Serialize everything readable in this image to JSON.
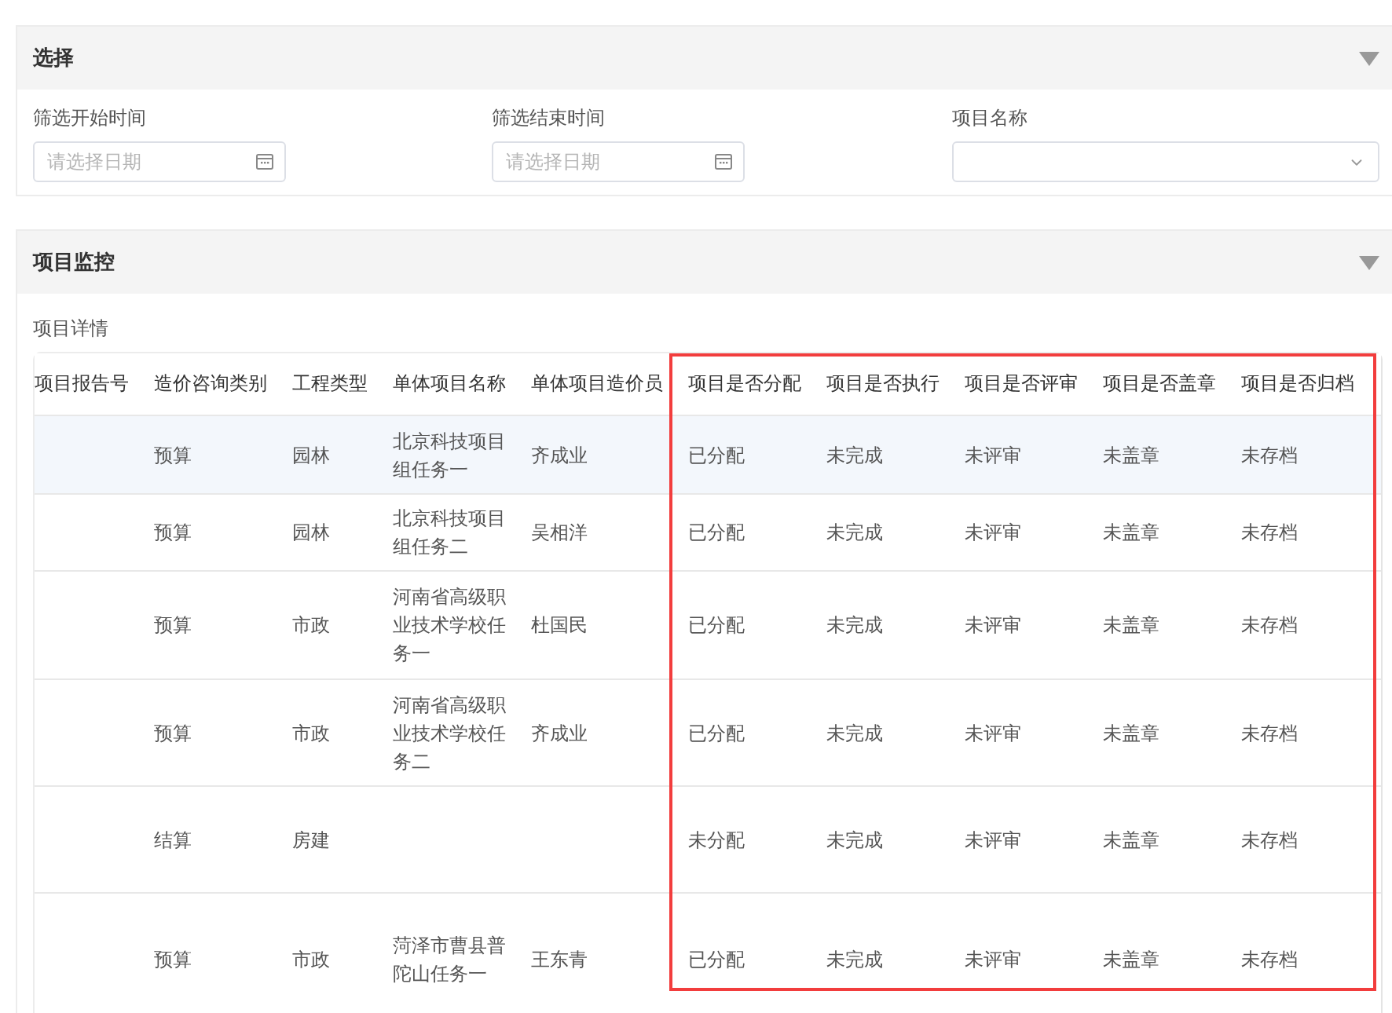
{
  "filter_panel": {
    "title": "选择",
    "fields": [
      {
        "label": "筛选开始时间",
        "kind": "date",
        "placeholder": "请选择日期"
      },
      {
        "label": "筛选结束时间",
        "kind": "date",
        "placeholder": "请选择日期"
      },
      {
        "label": "项目名称",
        "kind": "select"
      }
    ]
  },
  "monitor_panel": {
    "title": "项目监控",
    "section_label": "项目详情",
    "table": {
      "columns": [
        "项目报告号",
        "造价咨询类别",
        "工程类型",
        "单体项目名称",
        "单体项目造价员",
        "项目是否分配",
        "项目是否执行",
        "项目是否评审",
        "项目是否盖章",
        "项目是否归档"
      ],
      "annotation": {
        "kind": "frame"
      },
      "rows": [
        {
          "hovered": true,
          "cells": [
            null,
            "预算",
            "园林",
            "北京科技项目组任务一",
            "齐成业",
            "已分配",
            "未完成",
            "未评审",
            "未盖章",
            "未存档"
          ]
        },
        {
          "hovered": false,
          "cells": [
            null,
            "预算",
            "园林",
            "北京科技项目组任务二",
            "吴相洋",
            "已分配",
            "未完成",
            "未评审",
            "未盖章",
            "未存档"
          ]
        },
        {
          "hovered": false,
          "cells": [
            null,
            "预算",
            "市政",
            "河南省高级职业技术学校任务一",
            "杜国民",
            "已分配",
            "未完成",
            "未评审",
            "未盖章",
            "未存档"
          ]
        },
        {
          "hovered": false,
          "cells": [
            null,
            "预算",
            "市政",
            "河南省高级职业技术学校任务二",
            "齐成业",
            "已分配",
            "未完成",
            "未评审",
            "未盖章",
            "未存档"
          ]
        },
        {
          "hovered": false,
          "cells": [
            null,
            "结算",
            "房建",
            null,
            null,
            "未分配",
            "未完成",
            "未评审",
            "未盖章",
            "未存档"
          ]
        },
        {
          "hovered": false,
          "cells": [
            null,
            "预算",
            "市政",
            "菏泽市曹县普陀山任务一",
            "王东青",
            "已分配",
            "未完成",
            "未评审",
            "未盖章",
            "未存档"
          ]
        }
      ]
    }
  }
}
